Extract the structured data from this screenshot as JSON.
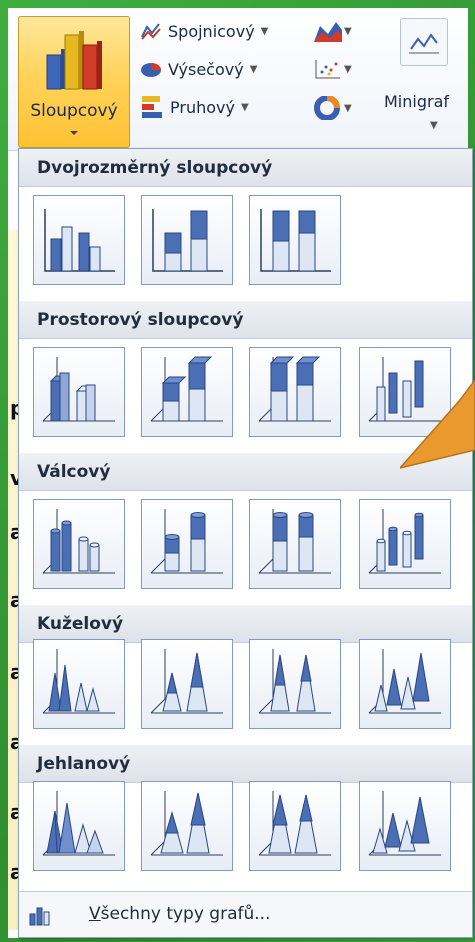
{
  "ribbon": {
    "column_button": "Sloupcový",
    "line_button": "Spojnicový",
    "pie_button": "Výsečový",
    "bar_button": "Pruhový",
    "sparklines_button": "Minigraf"
  },
  "gallery": {
    "sections": [
      {
        "title": "Dvojrozměrný sloupcový",
        "count": 3
      },
      {
        "title": "Prostorový sloupcový",
        "count": 4
      },
      {
        "title": "Válcový",
        "count": 4
      },
      {
        "title": "Kuželový",
        "count": 4
      },
      {
        "title": "Jehlanový",
        "count": 4
      }
    ],
    "footer": {
      "underlined": "V",
      "rest": "šechny typy grafů..."
    }
  },
  "background_letters": [
    "p",
    "v",
    "a",
    "a",
    "a",
    "a",
    "a",
    "a"
  ],
  "colors": {
    "frame_green": "#3a9a3a",
    "selected_button": "#ffd35a",
    "callout_orange": "#e89a2e",
    "chart_blue": "#4a6fb5"
  }
}
